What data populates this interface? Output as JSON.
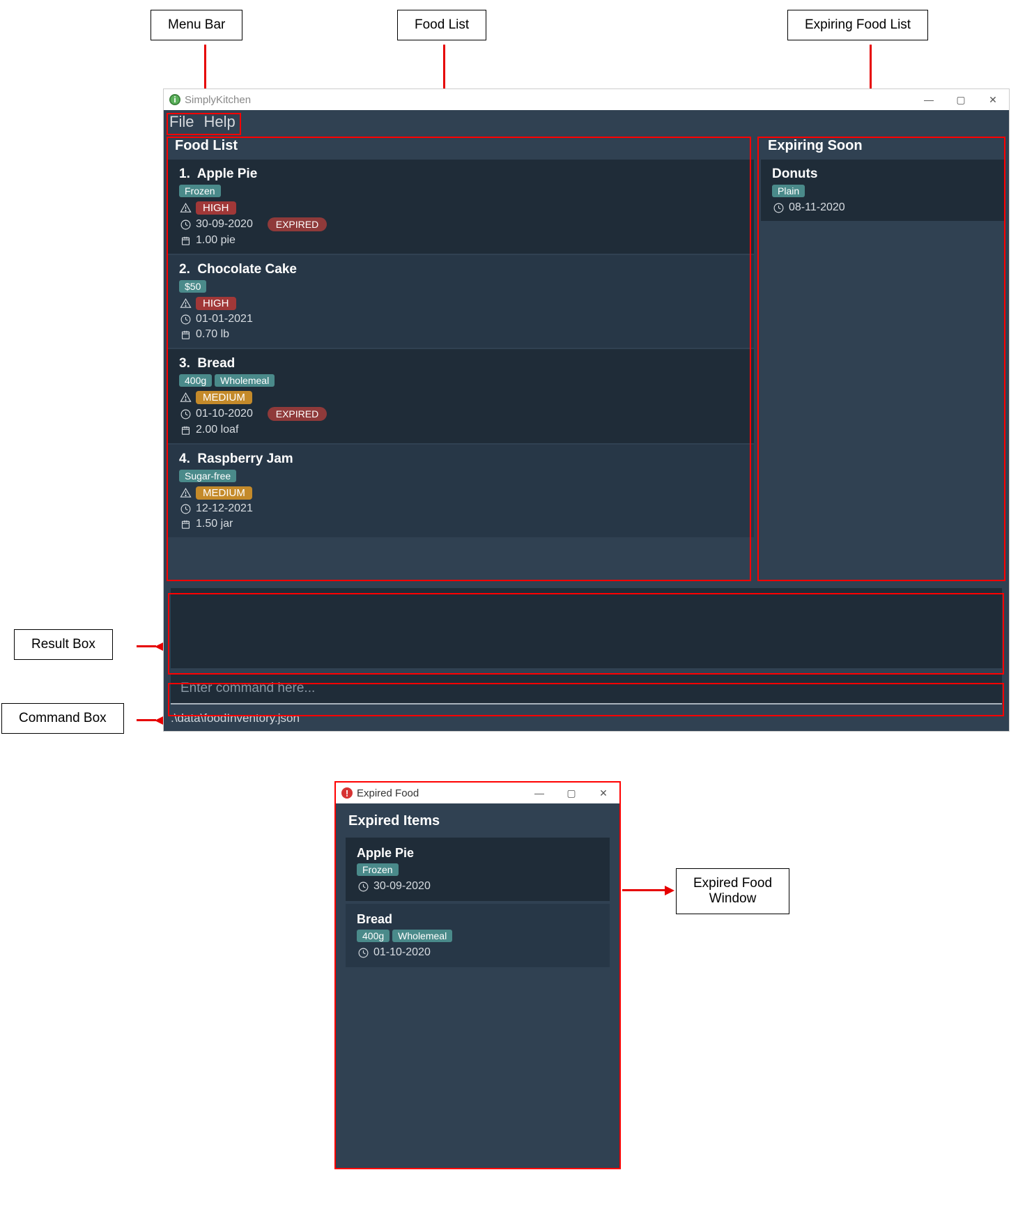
{
  "callouts": {
    "menu_bar": "Menu Bar",
    "food_list": "Food List",
    "expiring_list": "Expiring Food List",
    "result_box": "Result Box",
    "command_box": "Command Box",
    "expired_window": "Expired Food\nWindow"
  },
  "main_window": {
    "title": "SimplyKitchen",
    "menubar": {
      "file": "File",
      "help": "Help"
    },
    "food_list_header": "Food List",
    "expiring_header": "Expiring Soon",
    "food_items": [
      {
        "index": "1.",
        "name": "Apple Pie",
        "tags": [
          "Frozen"
        ],
        "priority": "HIGH",
        "priority_class": "prio-high",
        "date": "30-09-2020",
        "expired": "EXPIRED",
        "qty": "1.00 pie"
      },
      {
        "index": "2.",
        "name": "Chocolate Cake",
        "tags": [
          "$50"
        ],
        "priority": "HIGH",
        "priority_class": "prio-high",
        "date": "01-01-2021",
        "expired": "",
        "qty": "0.70 lb"
      },
      {
        "index": "3.",
        "name": "Bread",
        "tags": [
          "400g",
          "Wholemeal"
        ],
        "priority": "MEDIUM",
        "priority_class": "prio-medium",
        "date": "01-10-2020",
        "expired": "EXPIRED",
        "qty": "2.00 loaf"
      },
      {
        "index": "4.",
        "name": "Raspberry Jam",
        "tags": [
          "Sugar-free"
        ],
        "priority": "MEDIUM",
        "priority_class": "prio-medium",
        "date": "12-12-2021",
        "expired": "",
        "qty": "1.50 jar"
      }
    ],
    "expiring_items": [
      {
        "name": "Donuts",
        "tags": [
          "Plain"
        ],
        "date": "08-11-2020"
      }
    ],
    "command_placeholder": "Enter command here...",
    "status_path": ".\\data\\foodInventory.json"
  },
  "expired_window": {
    "title": "Expired Food",
    "header": "Expired Items",
    "items": [
      {
        "name": "Apple Pie",
        "tags": [
          "Frozen"
        ],
        "date": "30-09-2020"
      },
      {
        "name": "Bread",
        "tags": [
          "400g",
          "Wholemeal"
        ],
        "date": "01-10-2020"
      }
    ]
  }
}
